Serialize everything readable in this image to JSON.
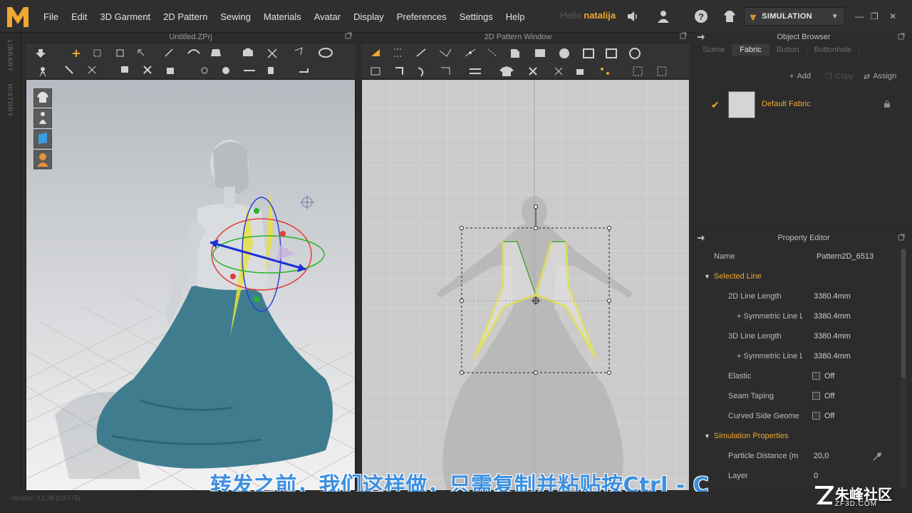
{
  "app": {
    "menu": [
      "File",
      "Edit",
      "3D Garment",
      "2D Pattern",
      "Sewing",
      "Materials",
      "Avatar",
      "Display",
      "Preferences",
      "Settings",
      "Help"
    ],
    "user_prefix": "Hello",
    "user_name": "natalija",
    "simulation_label": "SIMULATION",
    "accent_color": "#f0a830"
  },
  "side_tabs": [
    "LIBRARY",
    "HISTORY"
  ],
  "view3d": {
    "title": "Untitled.ZPrj"
  },
  "view2d": {
    "title": "2D Pattern Window"
  },
  "object_browser": {
    "title": "Object Browser",
    "tabs": [
      "Scene",
      "Fabric",
      "Button",
      "Buttonhole"
    ],
    "active_tab": "Fabric",
    "buttons": {
      "add": "Add",
      "copy": "Copy",
      "assign": "Assign"
    },
    "fabric_name": "Default Fabric"
  },
  "property_editor": {
    "title": "Property Editor",
    "name_label": "Name",
    "name_value": "Pattern2D_6513",
    "selected_line_header": "Selected Line",
    "line_2d_label": "2D Line Length",
    "line_2d_value": "3380.4mm",
    "sym_line_label_1": "+ Symmetric Line Le",
    "sym_line_value_1": "3380.4mm",
    "line_3d_label": "3D Line Length",
    "line_3d_value": "3380.4mm",
    "sym_line_label_2": "+ Symmetric Line Le",
    "sym_line_value_2": "3380.4mm",
    "elastic_label": "Elastic",
    "elastic_value": "Off",
    "seam_label": "Seam Taping",
    "seam_value": "Off",
    "curved_label": "Curved Side Geome",
    "curved_value": "Off",
    "sim_header": "Simulation Properties",
    "particle_label": "Particle Distance (m",
    "particle_value": "20,0",
    "layer_label": "Layer",
    "layer_value": "0"
  },
  "subtitle": "转发之前，我们这样做，只需复制并粘贴按Ctrl - C",
  "version": "Version: 3.1.38 (r25775)",
  "watermark": {
    "text": "朱峰社区",
    "url": "ZF3D.COM"
  }
}
